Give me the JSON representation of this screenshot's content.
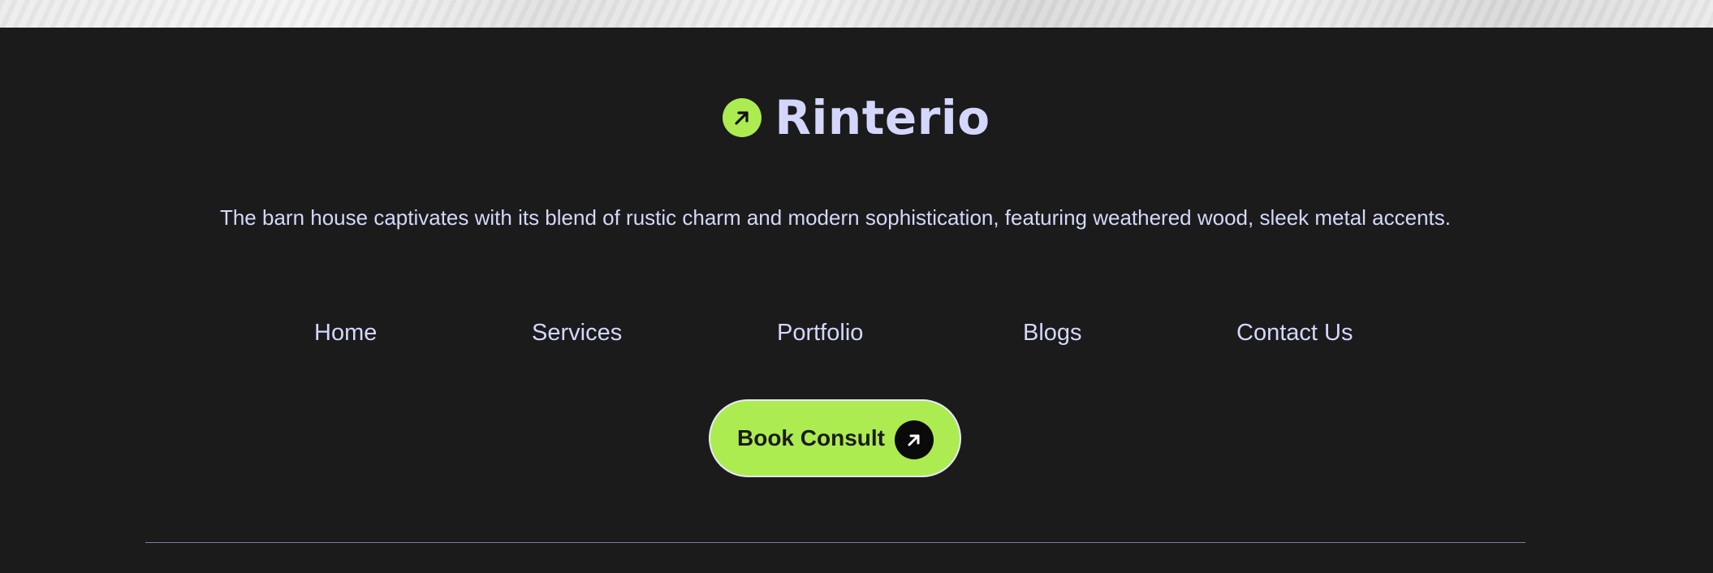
{
  "brand": {
    "name": "Rinterio",
    "icon": "arrow-up-right-icon"
  },
  "footer": {
    "tagline": "The barn house captivates with its blend of rustic charm and modern sophistication, featuring weathered wood, sleek metal accents."
  },
  "nav": {
    "items": [
      {
        "label": "Home"
      },
      {
        "label": "Services"
      },
      {
        "label": "Portfolio"
      },
      {
        "label": "Blogs"
      },
      {
        "label": "Contact Us"
      }
    ]
  },
  "cta": {
    "label": "Book Consult",
    "icon": "arrow-up-right-icon"
  },
  "colors": {
    "background": "#1b1b1b",
    "accent": "#acec50",
    "text": "#d4d7fb",
    "divider": "#7b7e98"
  }
}
